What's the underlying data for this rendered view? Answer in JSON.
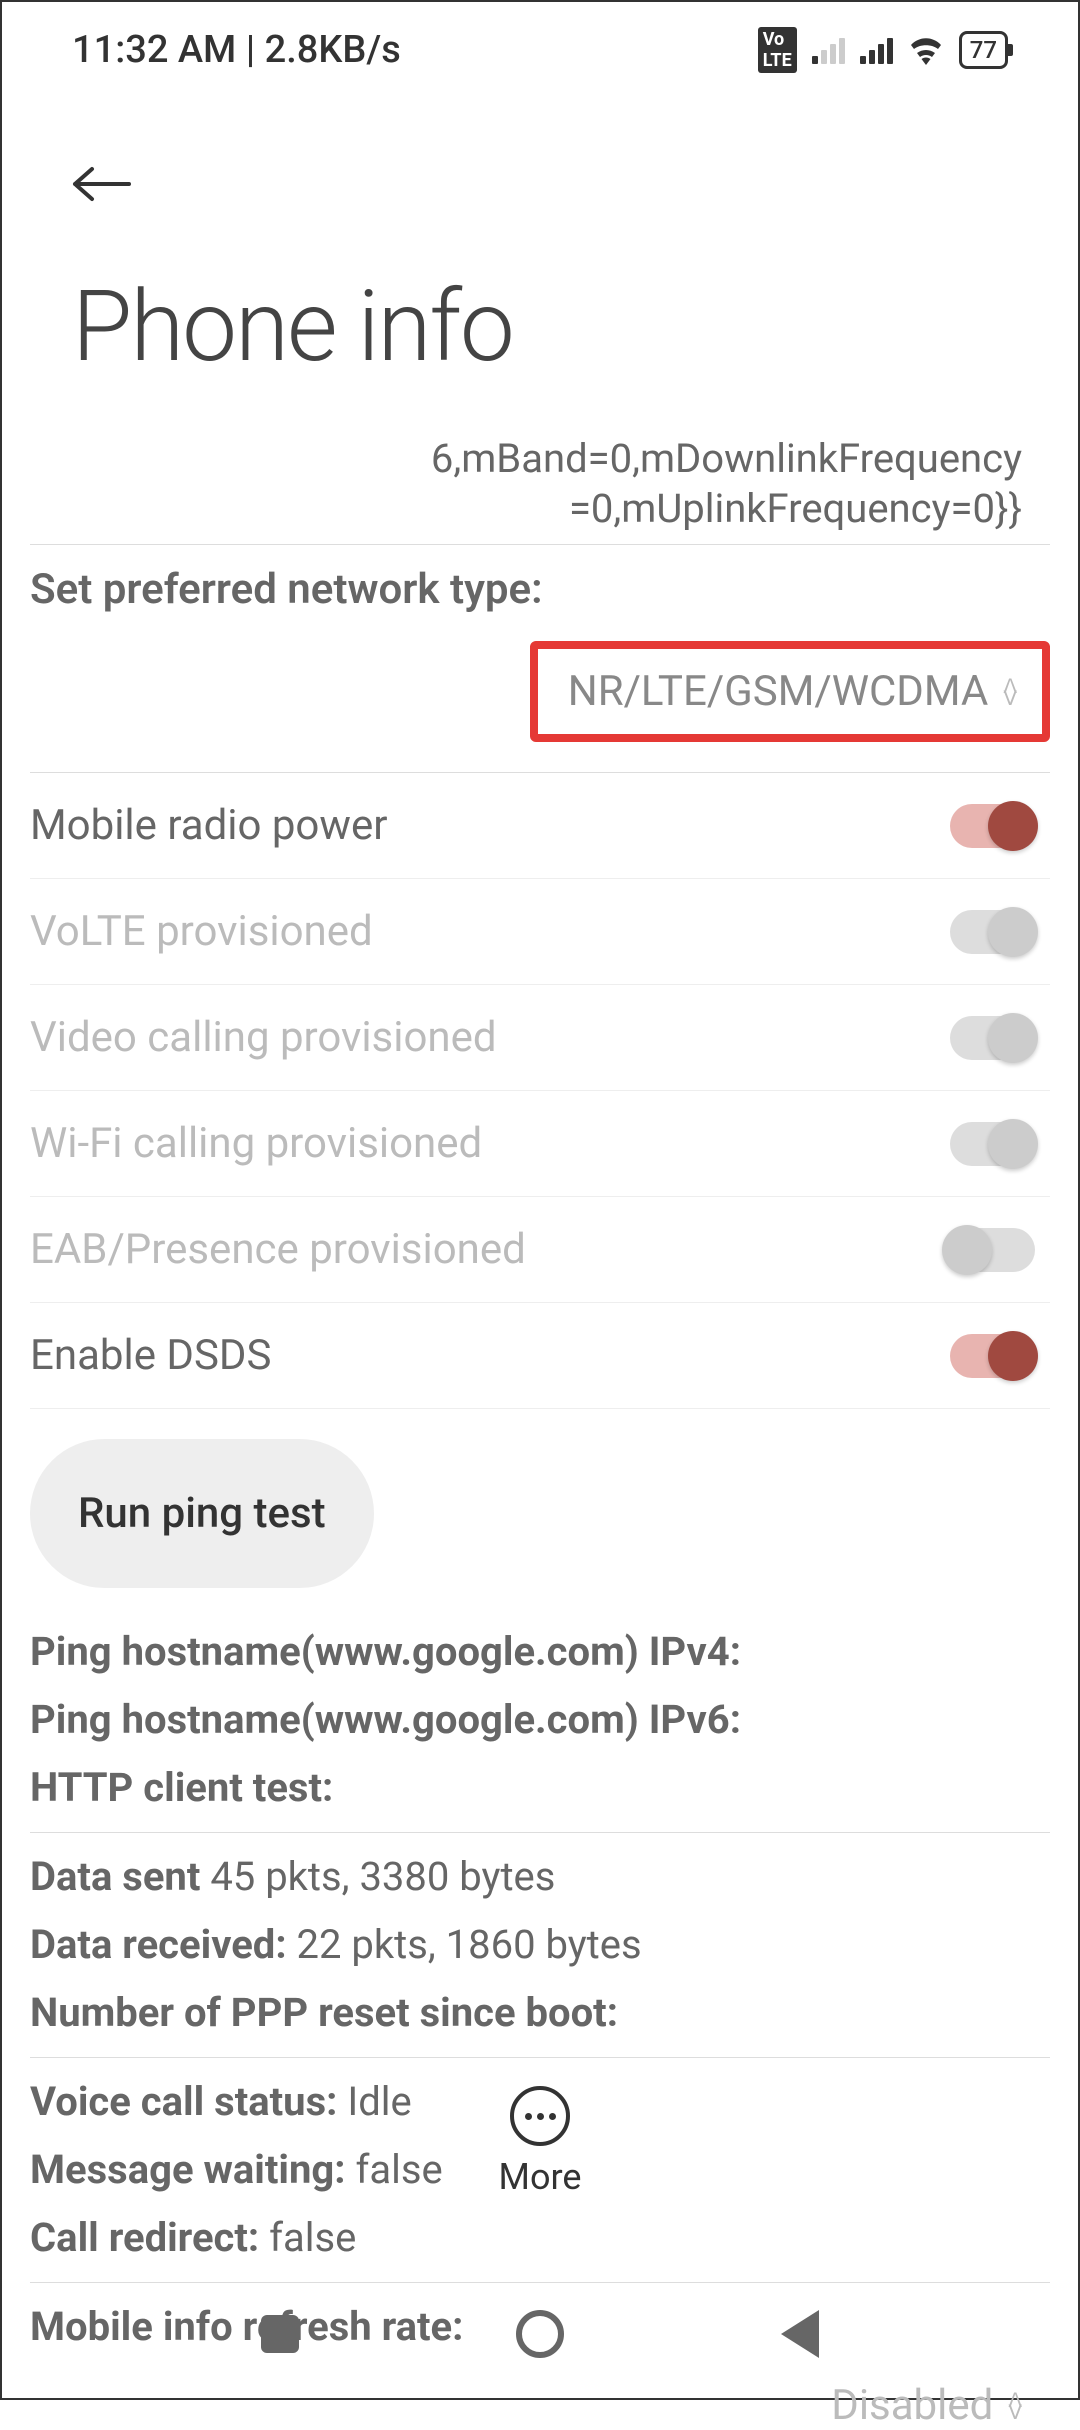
{
  "status_bar": {
    "time": "11:32 AM | 2.8KB/s",
    "battery": "77"
  },
  "header": {
    "title": "Phone info"
  },
  "info_text": "6,mBand=0,mDownlinkFrequency=0,mUplinkFrequency=0}}",
  "network_type": {
    "label": "Set preferred network type:",
    "value": "NR/LTE/GSM/WCDMA"
  },
  "toggles": [
    {
      "label": "Mobile radio power",
      "state": "on",
      "enabled": true
    },
    {
      "label": "VoLTE provisioned",
      "state": "on-disabled",
      "enabled": false
    },
    {
      "label": "Video calling provisioned",
      "state": "on-disabled",
      "enabled": false
    },
    {
      "label": "Wi-Fi calling provisioned",
      "state": "on-disabled",
      "enabled": false
    },
    {
      "label": "EAB/Presence provisioned",
      "state": "off-disabled",
      "enabled": false
    },
    {
      "label": "Enable DSDS",
      "state": "on",
      "enabled": true
    }
  ],
  "ping_button": "Run ping test",
  "info_lines": {
    "ping_v4_label": "Ping hostname(www.google.com) IPv4:",
    "ping_v6_label": "Ping hostname(www.google.com) IPv6:",
    "http_test_label": "HTTP client test:",
    "data_sent_label": "Data sent",
    "data_sent_value": " 45 pkts, 3380 bytes",
    "data_received_label": "Data received:",
    "data_received_value": " 22 pkts, 1860 bytes",
    "ppp_reset_label": "Number of PPP reset since boot:",
    "voice_call_label": "Voice call status:",
    "voice_call_value": " Idle",
    "message_waiting_label": "Message waiting:",
    "message_waiting_value": " false",
    "call_redirect_label": "Call redirect:",
    "call_redirect_value": " false",
    "refresh_rate_label": "Mobile info refresh rate:"
  },
  "refresh_dropdown": "Disabled",
  "more_label": "More"
}
